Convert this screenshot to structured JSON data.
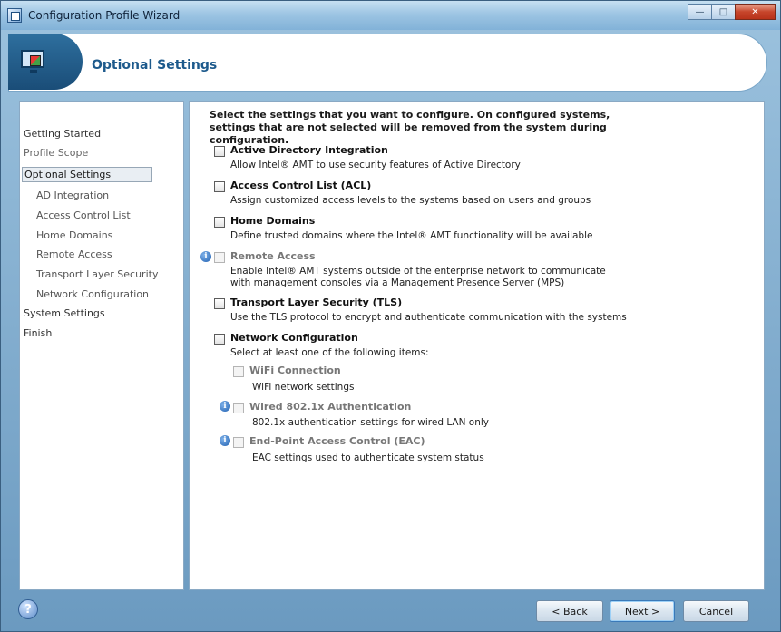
{
  "window": {
    "title": "Configuration Profile Wizard",
    "controls": {
      "minimize": "—",
      "maximize": "□",
      "close": "✕"
    }
  },
  "header": {
    "title": "Optional Settings"
  },
  "nav": {
    "items": [
      {
        "label": "Getting Started"
      },
      {
        "label": "Profile Scope"
      },
      {
        "label": "Optional Settings"
      },
      {
        "label": "AD Integration"
      },
      {
        "label": "Access Control List"
      },
      {
        "label": "Home Domains"
      },
      {
        "label": "Remote Access"
      },
      {
        "label": "Transport Layer Security"
      },
      {
        "label": "Network Configuration"
      },
      {
        "label": "System Settings"
      },
      {
        "label": "Finish"
      }
    ]
  },
  "content": {
    "intro": "Select the settings that you want to configure. On configured systems, settings that are not selected will be removed from the system during configuration.",
    "options": [
      {
        "title": "Active Directory Integration",
        "desc": "Allow Intel® AMT to use security features of Active Directory"
      },
      {
        "title": "Access Control List (ACL)",
        "desc": "Assign customized access levels to the systems based on users and groups"
      },
      {
        "title": "Home Domains",
        "desc": "Define trusted domains where the Intel® AMT functionality will be available"
      },
      {
        "title": "Remote Access",
        "desc": "Enable Intel® AMT systems outside of the enterprise network to communicate with management consoles via a Management Presence Server (MPS)"
      },
      {
        "title": "Transport Layer Security (TLS)",
        "desc": "Use the TLS protocol to encrypt and authenticate communication with the systems"
      },
      {
        "title": "Network Configuration",
        "desc": "Select at least one of the following items:"
      }
    ],
    "suboptions": [
      {
        "title": "WiFi Connection",
        "desc": "WiFi network settings"
      },
      {
        "title": "Wired 802.1x Authentication",
        "desc": "802.1x authentication settings for wired LAN only"
      },
      {
        "title": "End-Point Access Control (EAC)",
        "desc": "EAC settings used to authenticate system status"
      }
    ]
  },
  "footer": {
    "help": "?",
    "back": "< Back",
    "next": "Next >",
    "cancel": "Cancel"
  },
  "icons": {
    "info": "i"
  }
}
